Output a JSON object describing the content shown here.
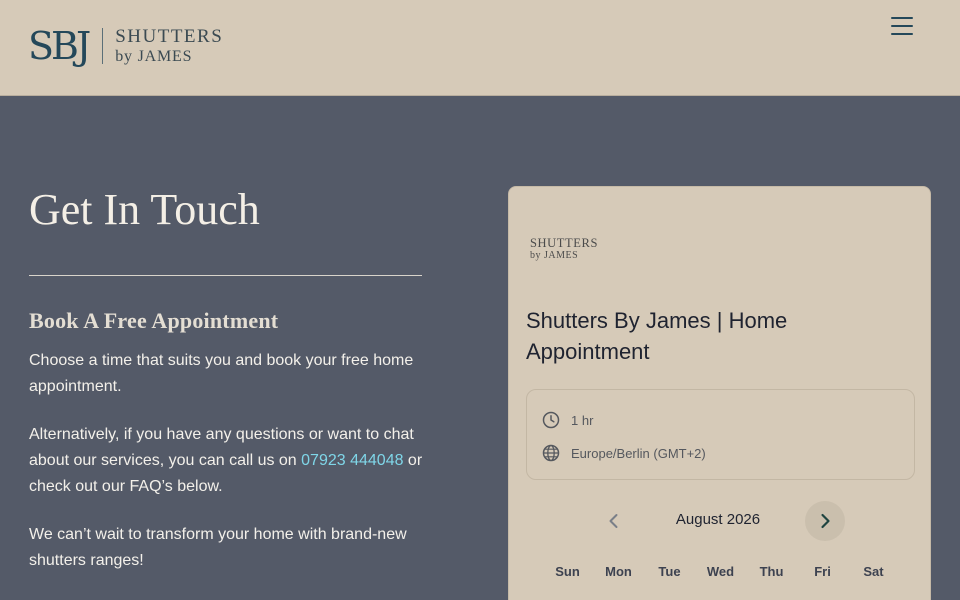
{
  "header": {
    "logo_mark": "SBJ",
    "logo_line1": "SHUTTERS",
    "logo_line2": "by JAMES",
    "menu_icon": "hamburger-menu-icon"
  },
  "contact": {
    "title": "Get In Touch",
    "subtitle": "Book A Free Appointment",
    "para1": "Choose a time that suits you and book your free home appointment.",
    "para2_before": "Alternatively, if you have any questions or want to chat about our services, you can call us on ",
    "phone": "07923 444048",
    "para2_after": " or check out our FAQ’s below.",
    "para3": "We can’t wait to transform your home with brand-new shutters ranges!"
  },
  "booking": {
    "logo_line1": "SHUTTERS",
    "logo_line2": "by JAMES",
    "event_title": "Shutters By James | Home Appointment",
    "duration": "1 hr",
    "duration_icon": "clock-icon",
    "timezone": "Europe/Berlin (GMT+2)",
    "timezone_icon": "globe-icon",
    "month": "August 2026",
    "prev_icon": "chevron-left-icon",
    "next_icon": "chevron-right-icon",
    "weekdays": [
      "Sun",
      "Mon",
      "Tue",
      "Wed",
      "Thu",
      "Fri",
      "Sat"
    ]
  },
  "colors": {
    "header_bg": "#d6cab8",
    "page_bg": "#545a68",
    "brand_teal": "#24485a",
    "link": "#7fd6e8",
    "card_bg": "#d6cab8"
  }
}
